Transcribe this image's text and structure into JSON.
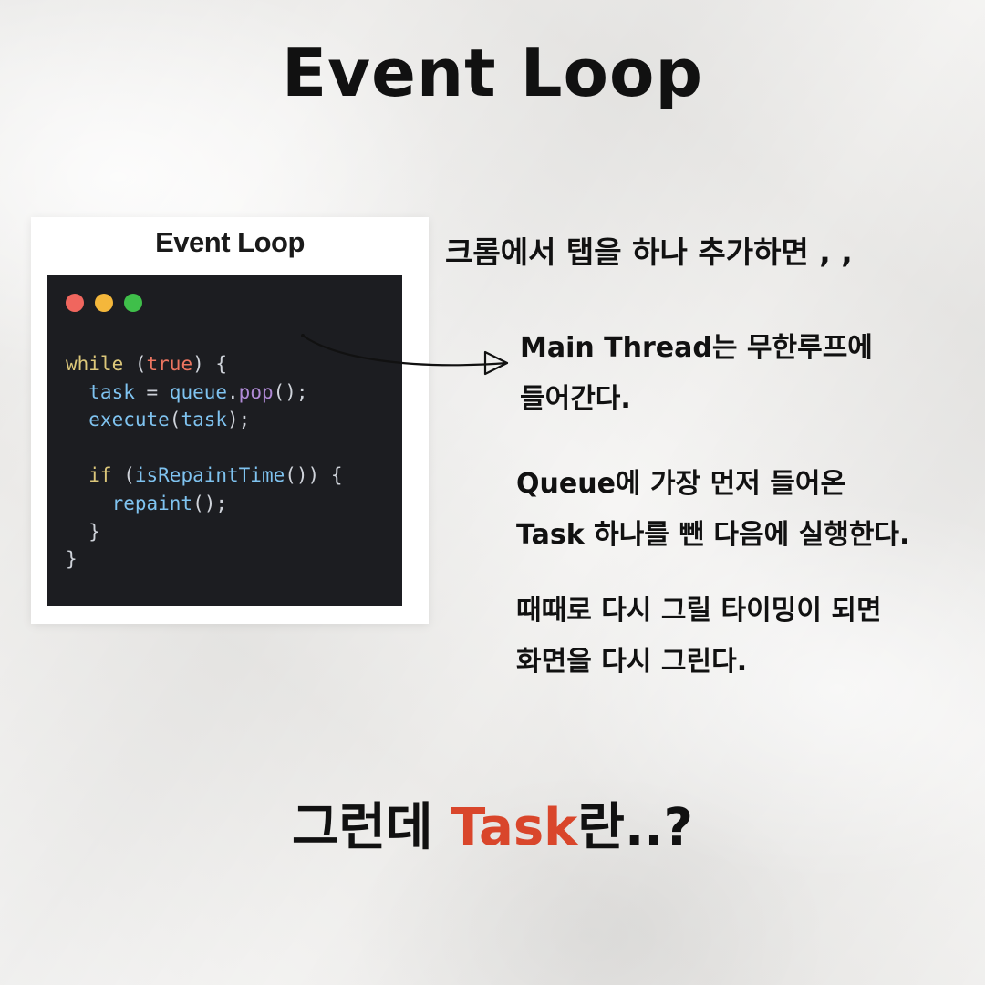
{
  "title": "Event Loop",
  "card": {
    "title": "Event Loop",
    "code_lines": [
      [
        {
          "t": "while",
          "c": "kw"
        },
        {
          "t": " (",
          "c": "punc"
        },
        {
          "t": "true",
          "c": "bool"
        },
        {
          "t": ") {",
          "c": "punc"
        }
      ],
      [
        {
          "t": "  task",
          "c": "var"
        },
        {
          "t": " = ",
          "c": "punc"
        },
        {
          "t": "queue",
          "c": "var"
        },
        {
          "t": ".",
          "c": "punc"
        },
        {
          "t": "pop",
          "c": "fn"
        },
        {
          "t": "();",
          "c": "punc"
        }
      ],
      [
        {
          "t": "  execute",
          "c": "var"
        },
        {
          "t": "(",
          "c": "punc"
        },
        {
          "t": "task",
          "c": "var"
        },
        {
          "t": ");",
          "c": "punc"
        }
      ],
      [],
      [
        {
          "t": "  if",
          "c": "kw"
        },
        {
          "t": " (",
          "c": "punc"
        },
        {
          "t": "isRepaintTime",
          "c": "var"
        },
        {
          "t": "()) {",
          "c": "punc"
        }
      ],
      [
        {
          "t": "    repaint",
          "c": "var"
        },
        {
          "t": "();",
          "c": "punc"
        }
      ],
      [
        {
          "t": "  }",
          "c": "punc"
        }
      ],
      [
        {
          "t": "}",
          "c": "punc"
        }
      ]
    ]
  },
  "caption": "크롬에서 탭을 하나 추가하면 , ,",
  "para1": [
    "Main Thread는 무한루프에",
    "들어간다."
  ],
  "para2": [
    "Queue에 가장 먼저 들어온",
    "Task 하나를 뺀 다음에 실행한다."
  ],
  "para3": [
    "때때로 다시 그릴 타이밍이 되면",
    "화면을 다시 그린다."
  ],
  "bottom": {
    "prefix": "그런데 ",
    "highlight": "Task",
    "suffix": "란..?"
  },
  "colors": {
    "accent": "#d9462b",
    "code_bg": "#1c1d21",
    "dot_red": "#f0665e",
    "dot_yellow": "#f4b73b",
    "dot_green": "#3fbf4a"
  }
}
